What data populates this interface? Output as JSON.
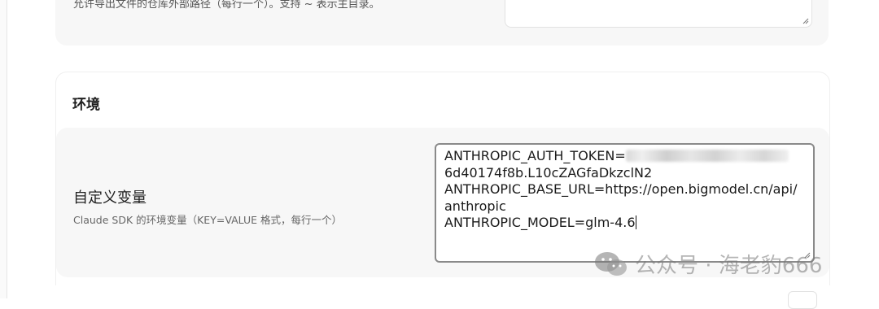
{
  "top_section": {
    "description": "允许导出文件的仓库外部路径（每行一个）。支持 ~ 表示主目录。"
  },
  "env_section": {
    "title": "环境",
    "custom_vars": {
      "label": "自定义变量",
      "hint": "Claude SDK 的环境变量（KEY=VALUE 格式，每行一个）",
      "lines": [
        "ANTHROPIC_AUTH_TOKEN=",
        "6d40174f8b.L10cZAGfaDkzclN2",
        "ANTHROPIC_BASE_URL=https://open.bigmodel.cn/api/",
        "anthropic",
        "ANTHROPIC_MODEL=glm-4.6"
      ]
    }
  },
  "watermark": {
    "text": "公众号 · 海老豹666",
    "icon": "wechat-icon"
  }
}
